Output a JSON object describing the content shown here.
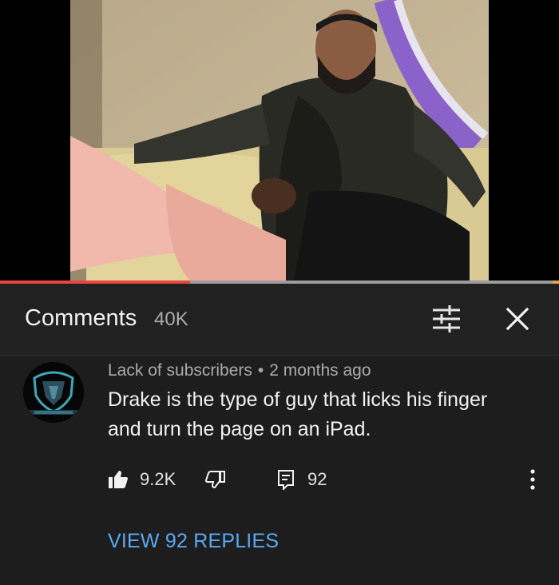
{
  "comments_panel": {
    "title": "Comments",
    "count": "40K"
  },
  "comment": {
    "author": "Lack of subscribers",
    "separator": "•",
    "timestamp": "2 months ago",
    "text": "Drake is the type of guy that licks his finger and turn the page on an iPad.",
    "likes": "9.2K",
    "reply_count": "92",
    "view_replies_label": "VIEW 92 REPLIES"
  },
  "video": {
    "progress_fraction": 0.34,
    "buffered_fraction": 0.99
  },
  "icons": {
    "filter": "sliders-icon",
    "close": "close-icon",
    "like": "thumbs-up-icon",
    "dislike": "thumbs-down-icon",
    "reply": "reply-icon",
    "more": "more-vertical-icon"
  },
  "colors": {
    "accent_red": "#e8463d",
    "link_blue": "#5aa9f2",
    "panel_bg": "#212121"
  }
}
